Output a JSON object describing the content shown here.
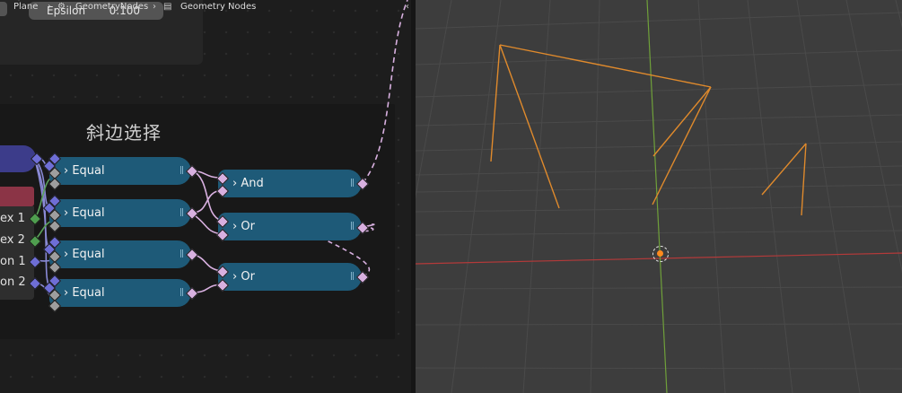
{
  "breadcrumb": {
    "object": "Plane",
    "modifier": "GeometryNodes",
    "tree": "Geometry Nodes"
  },
  "top_node": {
    "field_label": "Epsilon",
    "field_value": "0.100"
  },
  "frame": {
    "title": "斜边选择"
  },
  "partial_sockets": [
    "ex 1",
    "ex 2",
    "on 1",
    "on 2"
  ],
  "compare_nodes": [
    "Equal",
    "Equal",
    "Equal",
    "Equal"
  ],
  "logic_nodes": [
    "And",
    "Or",
    "Or"
  ],
  "colors": {
    "node_blue": "#1e5a78",
    "group_input": "#3c3c8a",
    "header_pink": "#8b3446",
    "selection_orange": "#e08a2c",
    "x_axis": "#b33a3a",
    "y_axis": "#6fa03a"
  },
  "icons": [
    "expand-chevron-icon",
    "mesh-icon",
    "modifier-icon",
    "node-tree-icon",
    "3d-cursor-icon"
  ]
}
